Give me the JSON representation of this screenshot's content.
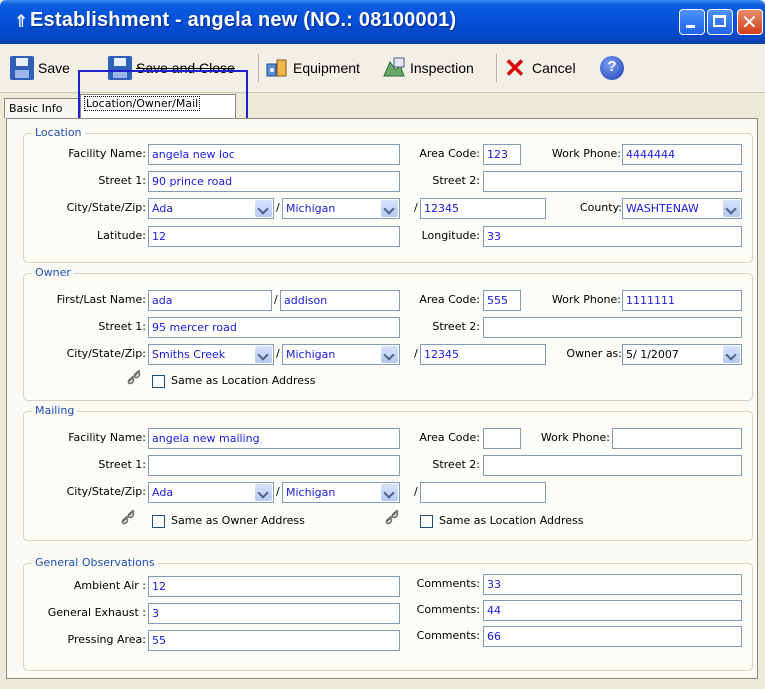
{
  "window": {
    "title": "Establishment - angela new (NO.: 08100001)",
    "app_icon": "⇑"
  },
  "toolbar": {
    "save": "Save",
    "save_close": "Save and Close",
    "equipment": "Equipment",
    "inspection": "Inspection",
    "cancel": "Cancel",
    "help": "?"
  },
  "tabs": {
    "basic": "Basic Info",
    "location": "Location/Owner/Mail"
  },
  "location": {
    "legend": "Location",
    "facility_label": "Facility Name:",
    "facility": "angela new loc",
    "area_label": "Area Code:",
    "area": "123",
    "phone_label": "Work Phone:",
    "phone": "4444444",
    "street1_label": "Street 1:",
    "street1": "90 prince road",
    "street2_label": "Street 2:",
    "street2": "",
    "csz_label": "City/State/Zip:",
    "city": "Ada",
    "state": "Michigan",
    "zip": "12345",
    "county_label": "County:",
    "county": "WASHTENAW",
    "lat_label": "Latitude:",
    "lat": "12",
    "lon_label": "Longitude:",
    "lon": "33"
  },
  "owner": {
    "legend": "Owner",
    "name_label": "First/Last Name:",
    "first": "ada",
    "last": "addison",
    "area_label": "Area Code:",
    "area": "555",
    "phone_label": "Work Phone:",
    "phone": "1111111",
    "street1_label": "Street 1:",
    "street1": "95 mercer road",
    "street2_label": "Street 2:",
    "street2": "",
    "csz_label": "City/State/Zip:",
    "city": "Smiths Creek",
    "state": "Michigan",
    "zip": "12345",
    "owner_as_label": "Owner as:",
    "owner_as": "5/ 1/2007",
    "same_loc": "Same as Location Address"
  },
  "mailing": {
    "legend": "Mailing",
    "facility_label": "Facility Name:",
    "facility": "angela new mailing",
    "area_label": "Area Code:",
    "area": "",
    "phone_label": "Work Phone:",
    "phone": "",
    "street1_label": "Street 1:",
    "street1": "",
    "street2_label": "Street 2:",
    "street2": "",
    "csz_label": "City/State/Zip:",
    "city": "Ada",
    "state": "Michigan",
    "zip": "",
    "same_owner": "Same as Owner Address",
    "same_loc": "Same as Location Address"
  },
  "observations": {
    "legend": "General Observations",
    "ambient_label": "Ambient Air :",
    "ambient": "12",
    "exhaust_label": "General Exhaust :",
    "exhaust": "3",
    "pressing_label": "Pressing Area:",
    "pressing": "55",
    "comments_label": "Comments:",
    "comment1": "33",
    "comment2": "44",
    "comment3": "66"
  }
}
